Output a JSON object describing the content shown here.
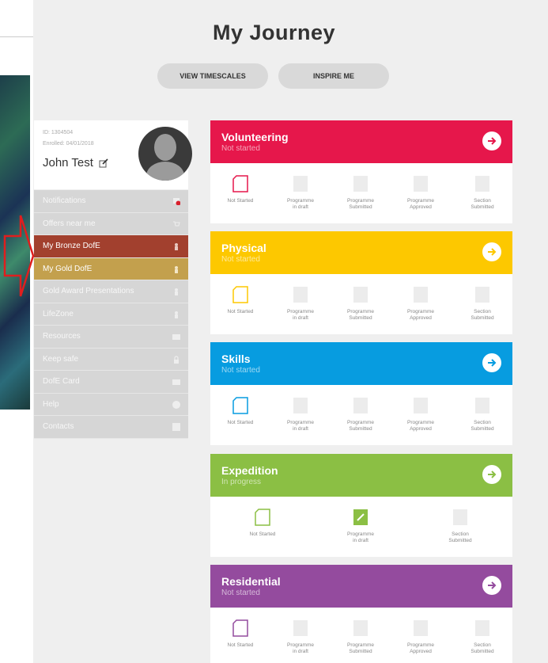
{
  "page": {
    "title": "My Journey"
  },
  "buttons": {
    "timescales": "VIEW TIMESCALES",
    "inspire": "INSPIRE ME"
  },
  "profile": {
    "id": "ID: 1304504",
    "enrolled": "Enrolled: 04/01/2018",
    "name": "John Test"
  },
  "menu": [
    {
      "label": "Notifications",
      "icon": "bell-icon",
      "badge": "!"
    },
    {
      "label": "Offers near me",
      "icon": "cart-icon"
    },
    {
      "label": "My Bronze DofE",
      "icon": "award-icon"
    },
    {
      "label": "My Gold DofE",
      "icon": "award-icon"
    },
    {
      "label": "Gold Award Presentations",
      "icon": "award-icon"
    },
    {
      "label": "LifeZone",
      "icon": "award-icon"
    },
    {
      "label": "Resources",
      "icon": "folder-icon"
    },
    {
      "label": "Keep safe",
      "icon": "lock-icon"
    },
    {
      "label": "DofE Card",
      "icon": "card-icon"
    },
    {
      "label": "Help",
      "icon": "help-icon"
    },
    {
      "label": "Contacts",
      "icon": "contact-icon"
    }
  ],
  "sections": {
    "volunteering": {
      "title": "Volunteering",
      "status": "Not started",
      "color": "#e6174b"
    },
    "physical": {
      "title": "Physical",
      "status": "Not started",
      "color": "#fdc800"
    },
    "skills": {
      "title": "Skills",
      "status": "Not started",
      "color": "#079ce0"
    },
    "expedition": {
      "title": "Expedition",
      "status": "In progress",
      "color": "#8bbf44"
    },
    "residential": {
      "title": "Residential",
      "status": "Not started",
      "color": "#944b9e"
    }
  },
  "steps": {
    "not_started": "Not Started",
    "in_draft": "Programme\nin draft",
    "submitted": "Programme\nSubmitted",
    "approved": "Programme\nApproved",
    "section_submitted": "Section\nSubmitted"
  }
}
